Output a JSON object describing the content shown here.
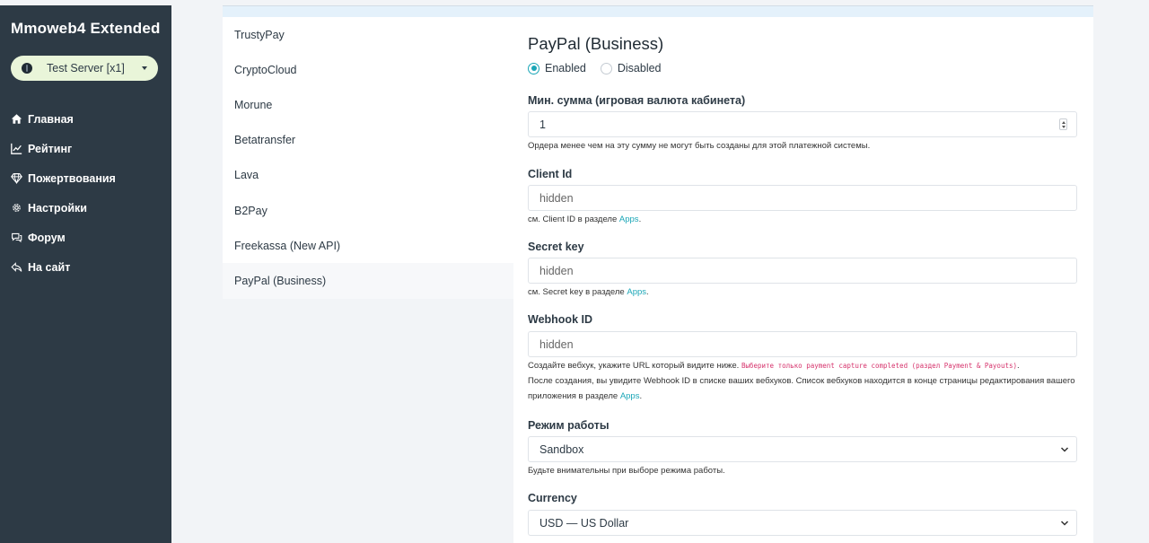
{
  "sidebar": {
    "brand": "Mmoweb4 Extended",
    "server": "Test Server [x1]",
    "items": [
      {
        "label": "Главная",
        "icon": "home-icon"
      },
      {
        "label": "Рейтинг",
        "icon": "chart-line-icon"
      },
      {
        "label": "Пожертвования",
        "icon": "diamond-icon"
      },
      {
        "label": "Настройки",
        "icon": "gear-icon"
      },
      {
        "label": "Форум",
        "icon": "chat-icon"
      },
      {
        "label": "На сайт",
        "icon": "reply-icon"
      }
    ]
  },
  "gateways": [
    "TrustyPay",
    "CryptoCloud",
    "Morune",
    "Betatransfer",
    "Lava",
    "B2Pay",
    "Freekassa (New API)",
    "PayPal (Business)"
  ],
  "form": {
    "title": "PayPal (Business)",
    "enabled_label": "Enabled",
    "disabled_label": "Disabled",
    "min_sum": {
      "label": "Мин. сумма (игровая валюта кабинета)",
      "value": "1",
      "hint": "Ордера менее чем на эту сумму не могут быть созданы для этой платежной системы."
    },
    "client_id": {
      "label": "Client Id",
      "placeholder": "hidden",
      "hint_prefix": "см. Client ID в разделе ",
      "hint_link": "Apps",
      "hint_suffix": "."
    },
    "secret_key": {
      "label": "Secret key",
      "placeholder": "hidden",
      "hint_prefix": "см. Secret key в разделе ",
      "hint_link": "Apps",
      "hint_suffix": "."
    },
    "webhook_id": {
      "label": "Webhook ID",
      "placeholder": "hidden",
      "hint_line1_prefix": "Создайте вебхук, укажите URL который видите ниже. ",
      "hint_line1_code": "Выберите только payment capture completed (раздел Payment & Payouts)",
      "hint_line1_suffix": ".",
      "hint_line2": "После создания, вы увидите Webhook ID в списке ваших вебхуков. Список вебхуков находится в конце страницы редактирования вашего",
      "hint_line3_prefix": "приложения в разделе ",
      "hint_line3_link": "Apps",
      "hint_line3_suffix": "."
    },
    "mode": {
      "label": "Режим работы",
      "value": "Sandbox",
      "hint": "Будьте внимательны при выборе режима работы."
    },
    "currency": {
      "label": "Currency",
      "value": "USD — US Dollar"
    }
  },
  "colors": {
    "sidebar_bg": "#2d3a45",
    "accent": "#1aa6b7",
    "server_pill": "#e9f5d9",
    "code": "#d6336c"
  }
}
